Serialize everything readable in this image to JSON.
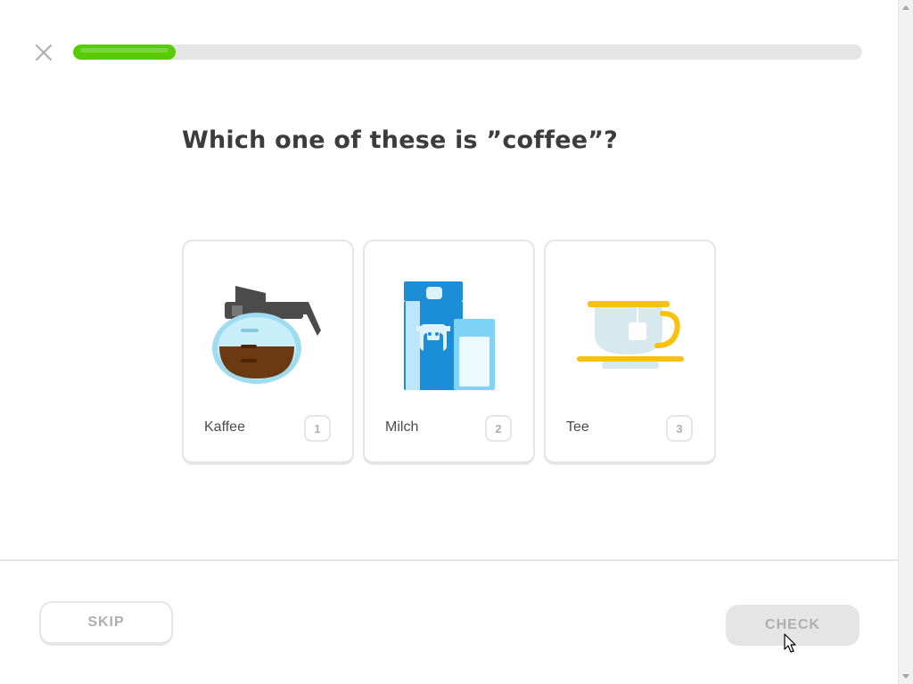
{
  "header": {
    "close_icon": "close-icon",
    "progress_fraction": 0.13,
    "progress_color": "#58cc02"
  },
  "question": {
    "text": "Which one of these is ”coffee”?"
  },
  "choices": [
    {
      "label": "Kaffee",
      "key": "1",
      "icon": "coffee-pot-icon"
    },
    {
      "label": "Milch",
      "key": "2",
      "icon": "milk-carton-icon"
    },
    {
      "label": "Tee",
      "key": "3",
      "icon": "tea-cup-icon"
    }
  ],
  "footer": {
    "skip_label": "SKIP",
    "check_label": "CHECK"
  },
  "colors": {
    "accent_green": "#58cc02",
    "border": "#e5e5e5",
    "text_dark": "#3c3c3c",
    "disabled_text": "#afafaf"
  }
}
